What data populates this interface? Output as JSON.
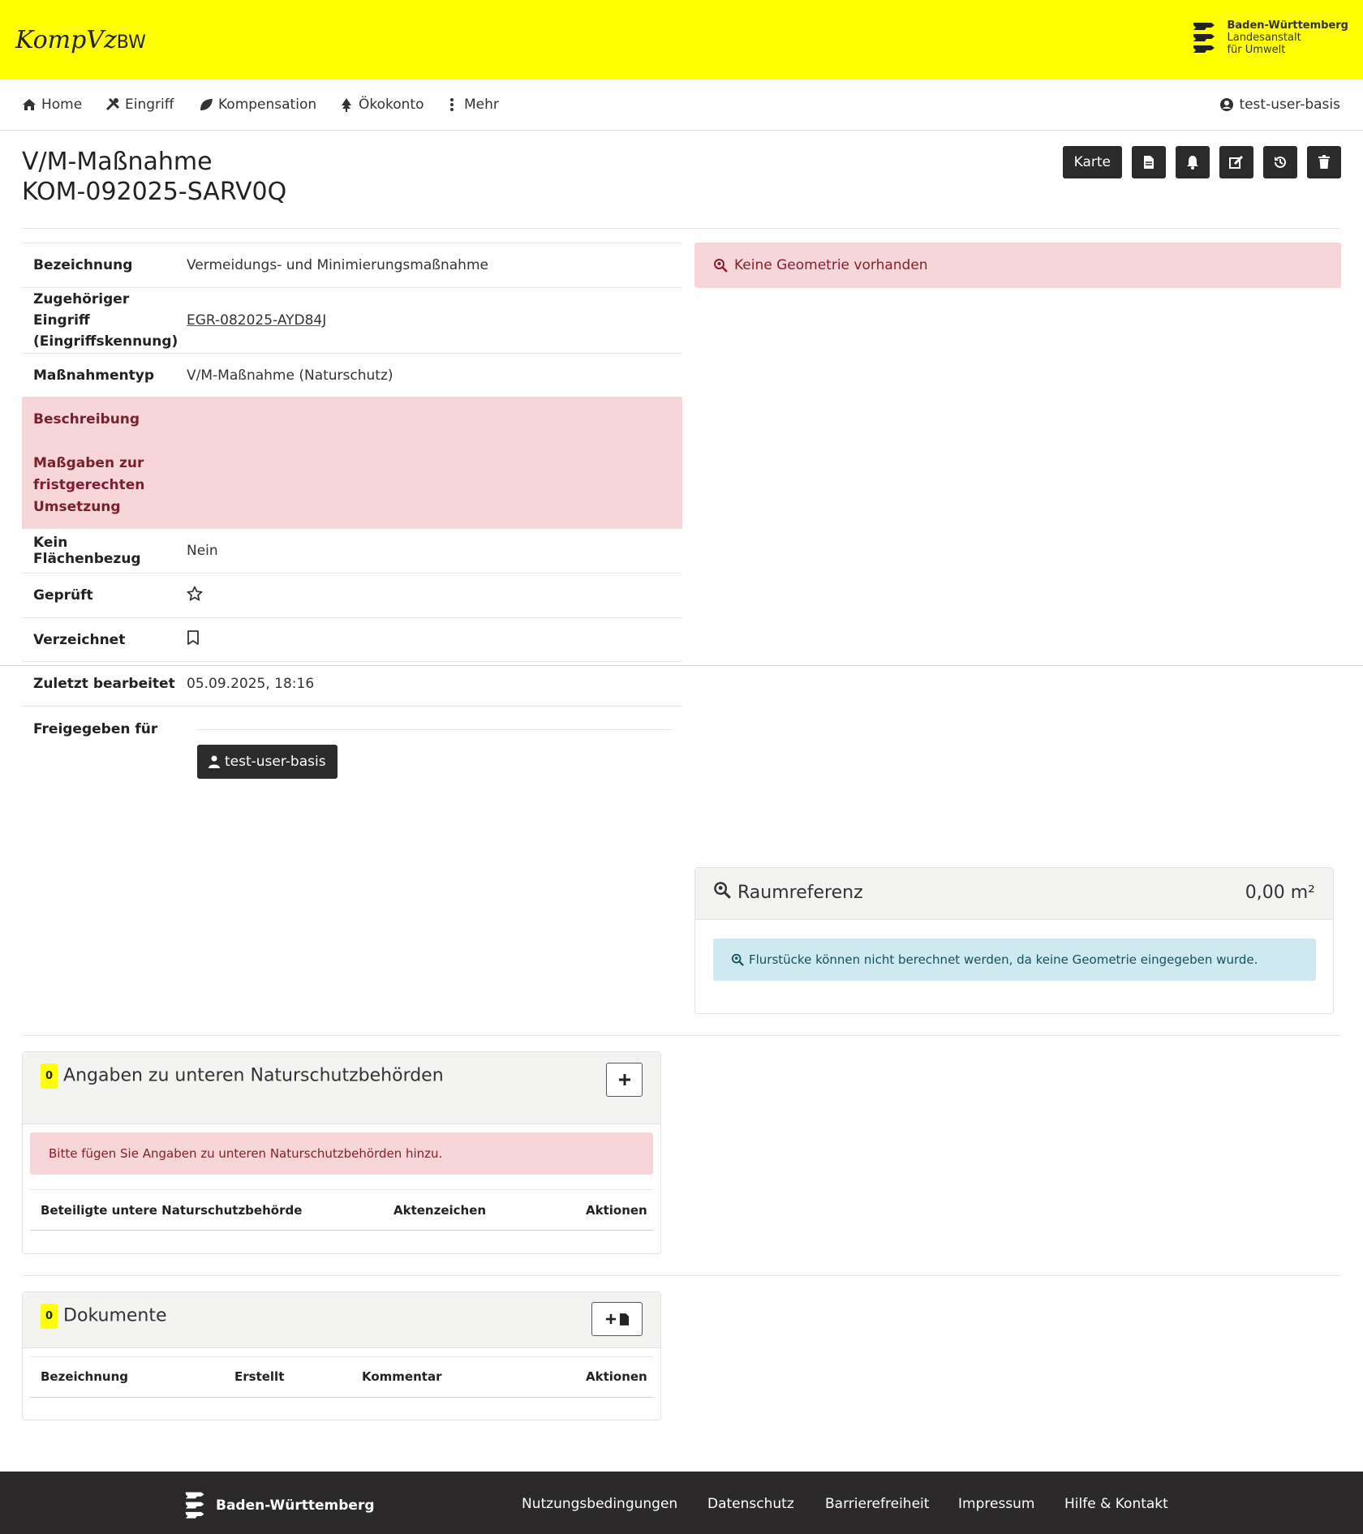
{
  "header": {
    "logo_main": "KompVz",
    "logo_suffix": "BW",
    "brand_line1": "Baden-Württemberg",
    "brand_line2": "Landesanstalt",
    "brand_line3": "für Umwelt"
  },
  "nav": {
    "home": "Home",
    "eingriff": "Eingriff",
    "kompensation": "Kompensation",
    "oekokonto": "Ökokonto",
    "mehr": "Mehr",
    "user": "test-user-basis"
  },
  "page": {
    "title_line1": "V/M-Maßnahme",
    "title_line2": "KOM-092025-SARV0Q"
  },
  "toolbar": {
    "karte": "Karte",
    "icons": [
      "document-icon",
      "bell-icon",
      "edit-icon",
      "history-icon",
      "trash-icon"
    ]
  },
  "details": {
    "bezeichnung_label": "Bezeichnung",
    "bezeichnung_value": "Vermeidungs- und Minimierungsmaßnahme",
    "eingriff_label": "Zugehöriger Eingriff (Eingriffskennung)",
    "eingriff_value": "EGR-082025-AYD84J",
    "typ_label": "Maßnahmentyp",
    "typ_value": "V/M-Maßnahme (Naturschutz)",
    "beschreibung_label": "Beschreibung",
    "massgaben_label": "Maßgaben zur fristgerechten Umsetzung",
    "flaechenbezug_label": "Kein Flächenbezug",
    "flaechenbezug_value": "Nein",
    "geprueft_label": "Geprüft",
    "verzeichnet_label": "Verzeichnet",
    "bearbeitet_label": "Zuletzt bearbeitet",
    "bearbeitet_value": "05.09.2025, 18:16",
    "freigegeben_label": "Freigegeben für",
    "freigegeben_user": "test-user-basis"
  },
  "geometry": {
    "alert": "Keine Geometrie vorhanden"
  },
  "raumreferenz": {
    "title": "Raumreferenz",
    "area": "0,00 m²",
    "info": "Flurstücke können nicht berechnet werden, da keine Geometrie eingegeben wurde."
  },
  "unb": {
    "count": "0",
    "title": "Angaben zu unteren Naturschutzbehörden",
    "alert": "Bitte fügen Sie Angaben zu unteren Naturschutzbehörden hinzu.",
    "col1": "Beteiligte untere Naturschutzbehörde",
    "col2": "Aktenzeichen",
    "col3": "Aktionen"
  },
  "dokumente": {
    "count": "0",
    "title": "Dokumente",
    "col1": "Bezeichnung",
    "col2": "Erstellt",
    "col3": "Kommentar",
    "col4": "Aktionen"
  },
  "footer": {
    "brand": "Baden-Württemberg",
    "links": [
      "Nutzungsbedingungen",
      "Datenschutz",
      "Barrierefreiheit",
      "Impressum",
      "Hilfe & Kontakt"
    ]
  }
}
